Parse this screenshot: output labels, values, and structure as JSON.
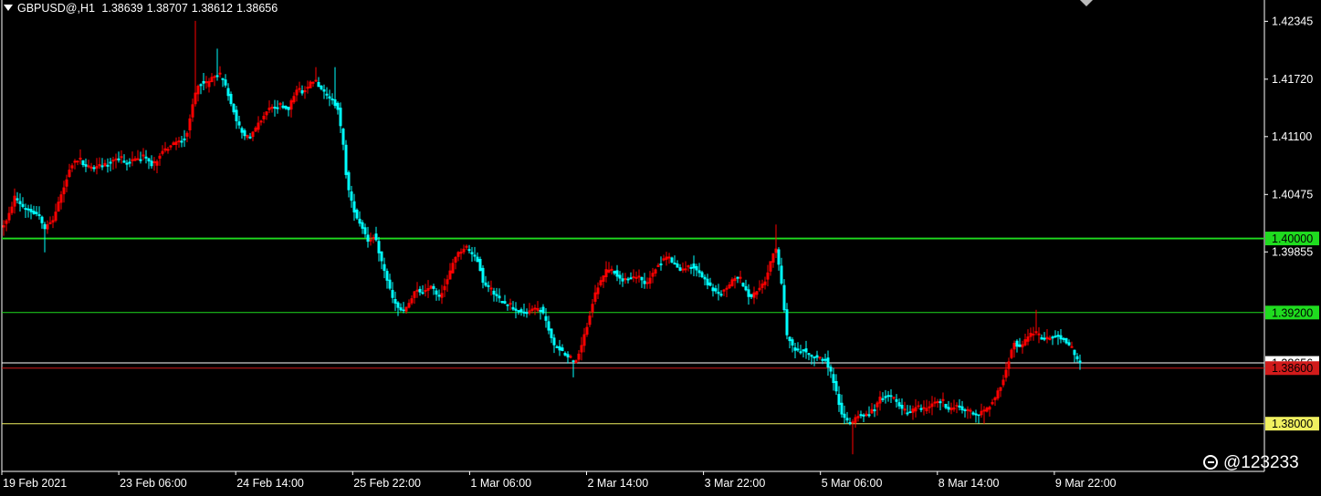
{
  "header": {
    "symbol": "GBPUSD@,H1",
    "open": "1.38639",
    "high": "1.38707",
    "low": "1.38612",
    "close": "1.38656"
  },
  "watermark": {
    "handle": "@123233",
    "icon": "weibo-icon"
  },
  "colors": {
    "background": "#000000",
    "bull": "#ff0000",
    "bear": "#00ffff",
    "axis": "#ffffff",
    "green_line": "#1fdc1f",
    "red_line": "#d11b1b",
    "white_line": "#e6e6e6",
    "yellow_line": "#f0f080"
  },
  "chart_data": {
    "type": "candlestick",
    "x_tick_labels": [
      "19 Feb 2021",
      "23 Feb 06:00",
      "24 Feb 14:00",
      "25 Feb 22:00",
      "1 Mar 06:00",
      "2 Mar 14:00",
      "3 Mar 22:00",
      "5 Mar 06:00",
      "8 Mar 14:00",
      "9 Mar 22:00"
    ],
    "y_tick_labels": [
      "1.42345",
      "1.41720",
      "1.41100",
      "1.40475",
      "1.39855"
    ],
    "ylim": [
      1.37485,
      1.42575
    ],
    "grid": false,
    "current_price": "1.38656",
    "levels": [
      {
        "value": 1.4,
        "label": "1.40000",
        "color": "#1fdc1f",
        "text_color": "#000000"
      },
      {
        "value": 1.392,
        "label": "1.39200",
        "color": "#1fdc1f",
        "text_color": "#000000"
      },
      {
        "value": 1.38656,
        "label": "1.38656",
        "color": "#ffffff",
        "text_color": "#000000"
      },
      {
        "value": 1.386,
        "label": "1.38600",
        "color": "#d11b1b",
        "text_color": "#000000"
      },
      {
        "value": 1.38,
        "label": "1.38000",
        "color": "#f0f060",
        "text_color": "#000000"
      }
    ],
    "path_points": [
      [
        0,
        1.401
      ],
      [
        8,
        1.402
      ],
      [
        16,
        1.4045
      ],
      [
        24,
        1.4035
      ],
      [
        32,
        1.403
      ],
      [
        44,
        1.4025
      ],
      [
        48,
        1.401
      ],
      [
        58,
        1.402
      ],
      [
        68,
        1.405
      ],
      [
        78,
        1.408
      ],
      [
        86,
        1.4085
      ],
      [
        96,
        1.4075
      ],
      [
        106,
        1.4078
      ],
      [
        118,
        1.4082
      ],
      [
        128,
        1.4088
      ],
      [
        138,
        1.4082
      ],
      [
        148,
        1.4085
      ],
      [
        158,
        1.4088
      ],
      [
        168,
        1.4078
      ],
      [
        176,
        1.4092
      ],
      [
        186,
        1.41
      ],
      [
        196,
        1.4105
      ],
      [
        204,
        1.411
      ],
      [
        212,
        1.415
      ],
      [
        218,
        1.417
      ],
      [
        226,
        1.4165
      ],
      [
        236,
        1.4178
      ],
      [
        244,
        1.4172
      ],
      [
        252,
        1.415
      ],
      [
        260,
        1.4125
      ],
      [
        268,
        1.411
      ],
      [
        276,
        1.4112
      ],
      [
        284,
        1.4125
      ],
      [
        294,
        1.414
      ],
      [
        306,
        1.4143
      ],
      [
        316,
        1.414
      ],
      [
        324,
        1.416
      ],
      [
        332,
        1.4158
      ],
      [
        342,
        1.417
      ],
      [
        350,
        1.4165
      ],
      [
        356,
        1.4155
      ],
      [
        364,
        1.415
      ],
      [
        370,
        1.414
      ],
      [
        376,
        1.41
      ],
      [
        380,
        1.406
      ],
      [
        386,
        1.4035
      ],
      [
        392,
        1.402
      ],
      [
        398,
        1.401
      ],
      [
        404,
        1.3995
      ],
      [
        410,
        1.4005
      ],
      [
        416,
        1.398
      ],
      [
        424,
        1.3955
      ],
      [
        430,
        1.3935
      ],
      [
        436,
        1.3925
      ],
      [
        442,
        1.392
      ],
      [
        448,
        1.393
      ],
      [
        456,
        1.3945
      ],
      [
        464,
        1.394
      ],
      [
        472,
        1.395
      ],
      [
        480,
        1.3935
      ],
      [
        490,
        1.3955
      ],
      [
        498,
        1.398
      ],
      [
        508,
        1.399
      ],
      [
        516,
        1.3985
      ],
      [
        524,
        1.3975
      ],
      [
        530,
        1.395
      ],
      [
        538,
        1.3945
      ],
      [
        546,
        1.3935
      ],
      [
        554,
        1.393
      ],
      [
        562,
        1.3925
      ],
      [
        572,
        1.392
      ],
      [
        582,
        1.3922
      ],
      [
        592,
        1.3925
      ],
      [
        600,
        1.3905
      ],
      [
        606,
        1.3885
      ],
      [
        614,
        1.388
      ],
      [
        624,
        1.387
      ],
      [
        630,
        1.3865
      ],
      [
        636,
        1.388
      ],
      [
        644,
        1.391
      ],
      [
        650,
        1.3935
      ],
      [
        656,
        1.395
      ],
      [
        664,
        1.3965
      ],
      [
        672,
        1.3965
      ],
      [
        680,
        1.3955
      ],
      [
        690,
        1.3957
      ],
      [
        700,
        1.3958
      ],
      [
        708,
        1.395
      ],
      [
        716,
        1.3965
      ],
      [
        724,
        1.3975
      ],
      [
        732,
        1.398
      ],
      [
        740,
        1.397
      ],
      [
        748,
        1.3965
      ],
      [
        756,
        1.3972
      ],
      [
        764,
        1.3965
      ],
      [
        772,
        1.3955
      ],
      [
        780,
        1.3945
      ],
      [
        788,
        1.394
      ],
      [
        796,
        1.3945
      ],
      [
        806,
        1.396
      ],
      [
        814,
        1.395
      ],
      [
        822,
        1.3935
      ],
      [
        830,
        1.3945
      ],
      [
        838,
        1.3955
      ],
      [
        844,
        1.3975
      ],
      [
        850,
        1.399
      ],
      [
        856,
        1.395
      ],
      [
        862,
        1.3895
      ],
      [
        870,
        1.388
      ],
      [
        880,
        1.388
      ],
      [
        888,
        1.3875
      ],
      [
        896,
        1.387
      ],
      [
        904,
        1.387
      ],
      [
        912,
        1.385
      ],
      [
        918,
        1.3825
      ],
      [
        924,
        1.3805
      ],
      [
        932,
        1.38
      ],
      [
        940,
        1.381
      ],
      [
        948,
        1.3808
      ],
      [
        956,
        1.3815
      ],
      [
        964,
        1.3828
      ],
      [
        972,
        1.383
      ],
      [
        980,
        1.3825
      ],
      [
        988,
        1.3815
      ],
      [
        996,
        1.381
      ],
      [
        1004,
        1.382
      ],
      [
        1012,
        1.3815
      ],
      [
        1020,
        1.382
      ],
      [
        1030,
        1.3825
      ],
      [
        1040,
        1.3815
      ],
      [
        1048,
        1.382
      ],
      [
        1056,
        1.3815
      ],
      [
        1064,
        1.3812
      ],
      [
        1072,
        1.381
      ],
      [
        1080,
        1.3815
      ],
      [
        1088,
        1.3825
      ],
      [
        1096,
        1.384
      ],
      [
        1104,
        1.3865
      ],
      [
        1110,
        1.389
      ],
      [
        1118,
        1.388
      ],
      [
        1126,
        1.3895
      ],
      [
        1134,
        1.3898
      ],
      [
        1142,
        1.389
      ],
      [
        1150,
        1.3893
      ],
      [
        1158,
        1.3895
      ],
      [
        1166,
        1.389
      ],
      [
        1174,
        1.388
      ],
      [
        1182,
        1.3866
      ]
    ],
    "wick_spikes": [
      [
        214,
        1.4235
      ],
      [
        238,
        1.4205
      ],
      [
        344,
        1.4185
      ],
      [
        366,
        1.4185
      ],
      [
        850,
        1.4015
      ],
      [
        1134,
        1.3923
      ],
      [
        934,
        1.3767
      ],
      [
        48,
        1.3985
      ],
      [
        628,
        1.385
      ],
      [
        1078,
        1.38
      ]
    ]
  }
}
